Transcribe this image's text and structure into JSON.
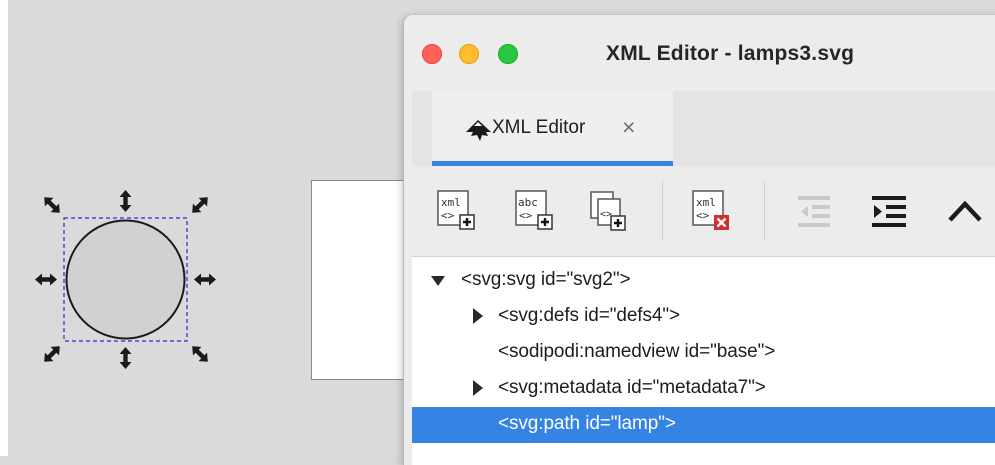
{
  "window": {
    "title": "XML Editor - lamps3.svg",
    "accent": "#3584e4"
  },
  "tab": {
    "icon": "inkscape-logo-icon",
    "label": "XML Editor",
    "close_glyph": "×"
  },
  "toolbar": {
    "buttons": [
      {
        "name": "new-element-node-button",
        "icon": "xml-new-element-icon",
        "text": "xml"
      },
      {
        "name": "new-text-node-button",
        "icon": "xml-new-text-icon",
        "text": "abc"
      },
      {
        "name": "duplicate-node-button",
        "icon": "xml-duplicate-icon"
      },
      {
        "name": "delete-node-button",
        "icon": "xml-delete-icon",
        "text": "xml"
      },
      {
        "name": "unindent-node-button",
        "icon": "unindent-icon",
        "disabled": true
      },
      {
        "name": "indent-node-button",
        "icon": "indent-icon"
      },
      {
        "name": "raise-node-button",
        "icon": "chevron-up-icon"
      }
    ]
  },
  "tree": {
    "nodes": [
      {
        "label": "<svg:svg id=\"svg2\">",
        "expander": "expanded"
      },
      {
        "label": "<svg:defs id=\"defs4\">",
        "expander": "collapsed"
      },
      {
        "label": "<sodipodi:namedview id=\"base\">",
        "expander": "none"
      },
      {
        "label": "<svg:metadata id=\"metadata7\">",
        "expander": "collapsed"
      },
      {
        "label": "<svg:path id=\"lamp\">",
        "expander": "none",
        "selected": true
      }
    ]
  },
  "canvas": {
    "selection": {
      "shape": "circle",
      "fill": "#d1d1d1",
      "handles": "scale-arrows"
    }
  }
}
